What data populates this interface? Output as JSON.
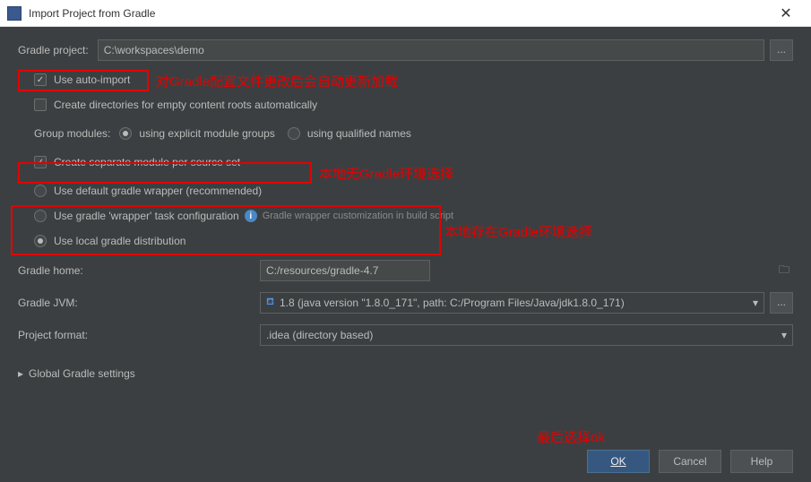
{
  "title": "Import Project from Gradle",
  "gradle_project": {
    "label": "Gradle project:",
    "value": "C:\\workspaces\\demo"
  },
  "auto_import": {
    "label": "Use auto-import",
    "checked": true
  },
  "create_dirs": {
    "label": "Create directories for empty content roots automatically",
    "checked": false
  },
  "group_modules": {
    "label": "Group modules:",
    "opt1": "using explicit module groups",
    "opt2": "using qualified names",
    "selected": 1
  },
  "separate_module": {
    "label": "Create separate module per source set",
    "checked": true
  },
  "wrapper": {
    "opt1": "Use default gradle wrapper (recommended)",
    "opt2": "Use gradle 'wrapper' task configuration",
    "opt2_hint": "Gradle wrapper customization in build script",
    "opt3": "Use local gradle distribution",
    "selected": 3
  },
  "gradle_home": {
    "label": "Gradle home:",
    "value": "C:/resources/gradle-4.7"
  },
  "gradle_jvm": {
    "label": "Gradle JVM:",
    "value": "1.8 (java version \"1.8.0_171\", path: C:/Program Files/Java/jdk1.8.0_171)"
  },
  "project_format": {
    "label": "Project format:",
    "value": ".idea (directory based)"
  },
  "global_settings": "Global Gradle settings",
  "annotations": {
    "a1": "对Gradle配置文件更改后会自动更新加载",
    "a2": "本地无Gradle环境选择",
    "a3": "本地存在Gradle环境选择",
    "a4": "最后选择ok"
  },
  "buttons": {
    "ok": "OK",
    "cancel": "Cancel",
    "help": "Help"
  },
  "browse": "..."
}
